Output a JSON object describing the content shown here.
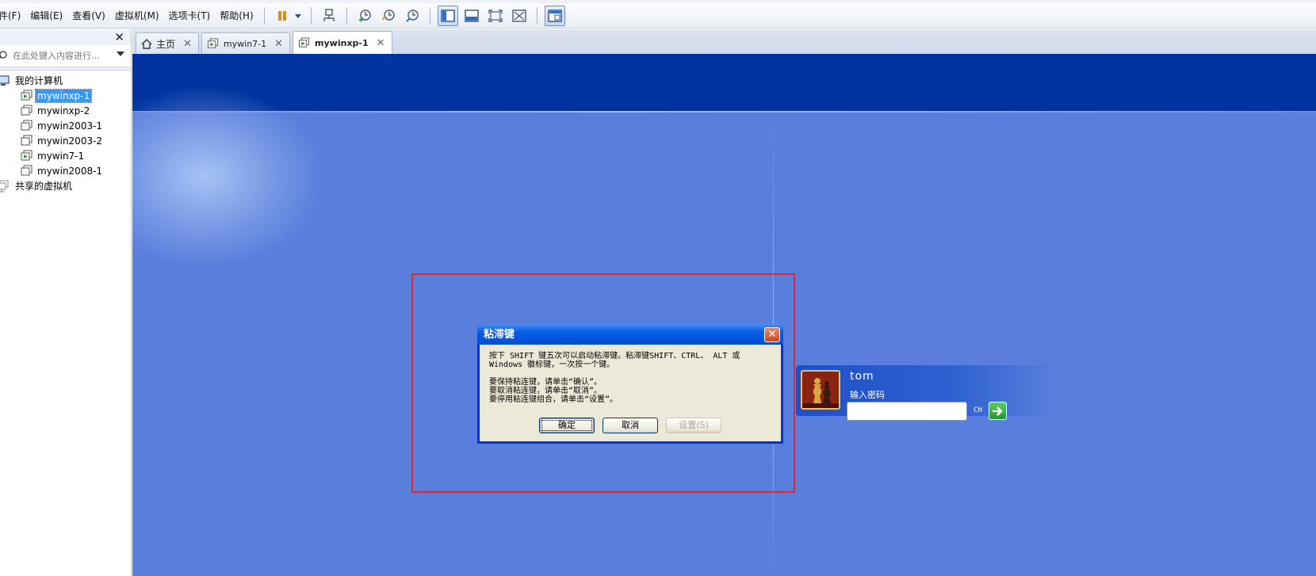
{
  "menu": [
    "件(F)",
    "编辑(E)",
    "查看(V)",
    "虚拟机(M)",
    "选项卡(T)",
    "帮助(H)"
  ],
  "toolbar": {
    "icons": [
      "pause-icon",
      "dropdown-arrow-icon",
      "send-ctrl-alt-del-icon",
      "snapshot-take-icon",
      "snapshot-revert-icon",
      "snapshot-manager-icon",
      "library-view-icon",
      "console-view-icon",
      "fullscreen-icon",
      "unity-icon",
      "tabs-view-icon"
    ],
    "accent": "#0a5be0"
  },
  "library": {
    "search_placeholder": "在此处键入内容进行...",
    "root_label": "我的计算机",
    "vms": [
      {
        "label": "mywinxp-1",
        "selected": true,
        "running": true
      },
      {
        "label": "mywinxp-2",
        "selected": false,
        "running": false
      },
      {
        "label": "mywin2003-1",
        "selected": false,
        "running": false
      },
      {
        "label": "mywin2003-2",
        "selected": false,
        "running": false
      },
      {
        "label": "mywin7-1",
        "selected": false,
        "running": true
      },
      {
        "label": "mywin2008-1",
        "selected": false,
        "running": false
      }
    ],
    "shared_label": "共享的虚拟机"
  },
  "tabs": [
    {
      "label": "主页",
      "active": false,
      "icon": "home-icon"
    },
    {
      "label": "mywin7-1",
      "active": false,
      "icon": "vm-icon"
    },
    {
      "label": "mywinxp-1",
      "active": true,
      "icon": "vm-icon"
    }
  ],
  "dialog": {
    "title": "粘滞键",
    "line1": "按下 SHIFT 键五次可以启动粘滞键。粘滞键SHIFT、CTRL、 ALT 或",
    "line2": "Windows 徽标键，一次按一个键。",
    "line3": "要保持粘连键，请单击“确认”。",
    "line4": "要取消粘连键，请单击“取消”。",
    "line5": "要停用粘连键组合，请单击“设置”。",
    "ok": "确定",
    "cancel": "取消",
    "settings": "设置(S)"
  },
  "login": {
    "username": "tom",
    "password_label": "输入密码",
    "lang": "CH"
  },
  "colors": {
    "desktop": "#5a7edc",
    "top_band": "#0033a0",
    "highlight": "#e8252a"
  }
}
